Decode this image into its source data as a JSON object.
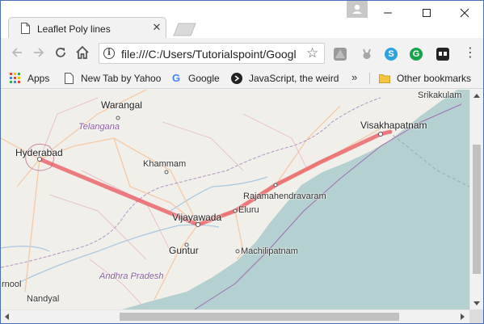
{
  "browser": {
    "tab_title": "Leaflet Poly lines",
    "url": "file:///C:/Users/Tutorialspoint/Googl"
  },
  "bookmarks": {
    "items": [
      {
        "label": "Apps",
        "icon": "apps-grid-icon"
      },
      {
        "label": "New Tab by Yahoo",
        "icon": "page-icon"
      },
      {
        "label": "Google",
        "icon": "google-icon"
      },
      {
        "label": "JavaScript, the weird",
        "icon": "js-icon"
      }
    ],
    "more": "»",
    "other": "Other bookmarks"
  },
  "map": {
    "places": {
      "srikakulam": "Srikakulam",
      "warangal": "Warangal",
      "telangana": "Telangana",
      "visakhapatnam": "Visakhapatnam",
      "hyderabad": "Hyderabad",
      "khammam": "Khammam",
      "rajamahendravaram": "Rajamahendravaram",
      "eluru": "Eluru",
      "vijayawada": "Vijayawada",
      "guntur": "Guntur",
      "machilipatnam": "Machilipatnam",
      "andhra": "Andhra Pradesh",
      "kurnool": "rnool",
      "nandyal": "Nandyal"
    },
    "polyline": {
      "color": "#e8545a",
      "points": [
        "Hyderabad",
        "Vijayawada",
        "Rajamahendravaram",
        "Visakhapatnam"
      ]
    },
    "colors": {
      "land": "#f1efe9",
      "sea": "#b5d0d0",
      "road": "#f6c9a6",
      "border": "#a06fb0"
    }
  }
}
